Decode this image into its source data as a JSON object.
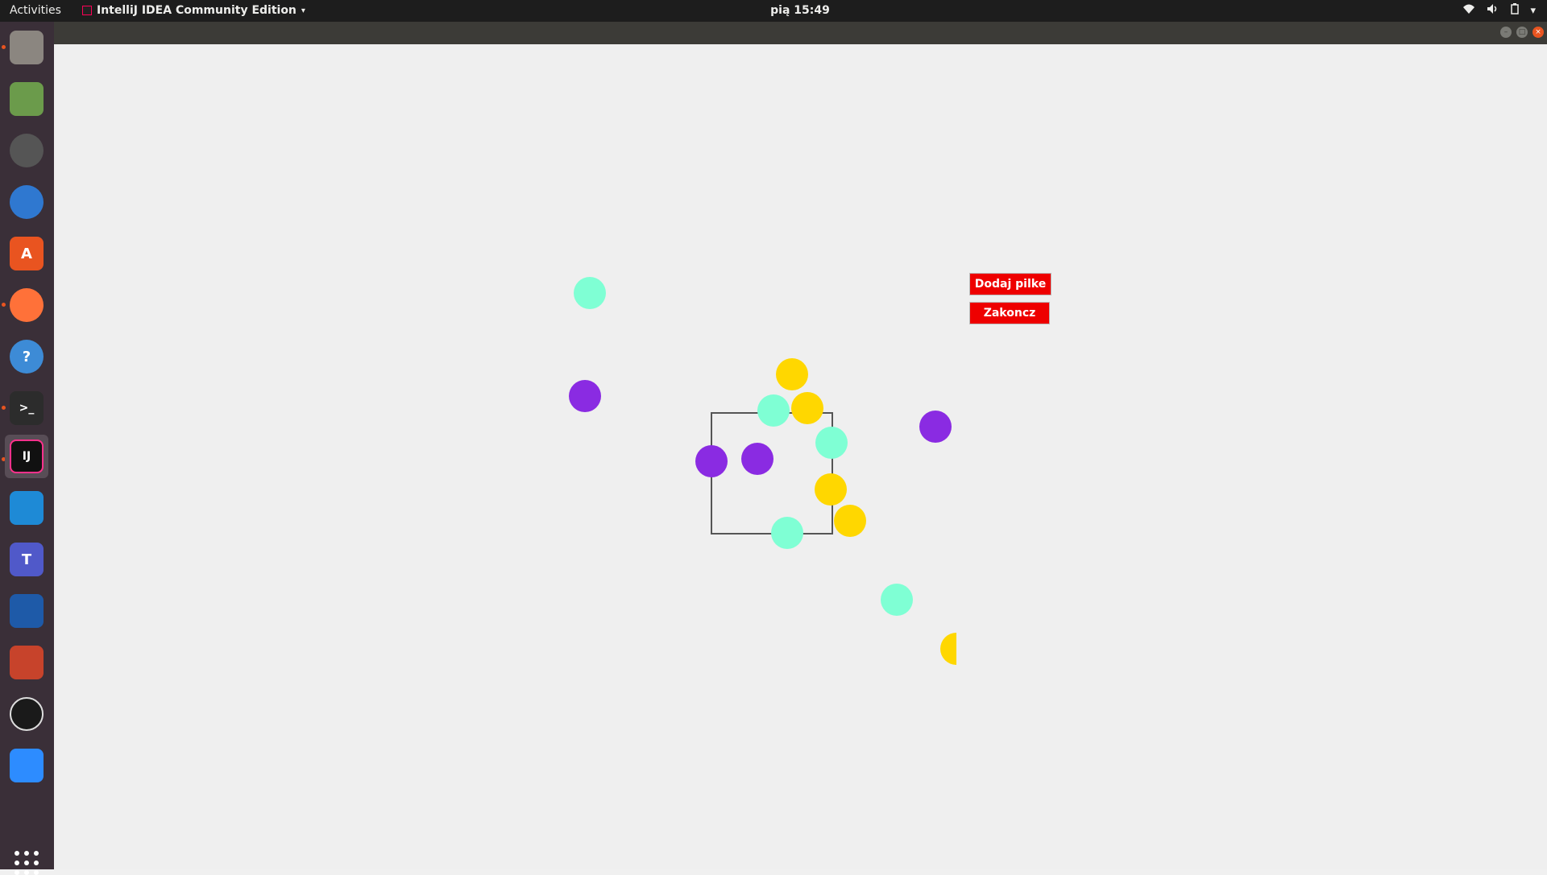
{
  "topbar": {
    "activities": "Activities",
    "app_name": "IntelliJ IDEA Community Edition",
    "clock": "pią 15:49"
  },
  "dock": {
    "items": [
      {
        "name": "files-icon"
      },
      {
        "name": "image-viewer-icon"
      },
      {
        "name": "rhythmbox-icon"
      },
      {
        "name": "thunderbird-icon"
      },
      {
        "name": "software-center-icon"
      },
      {
        "name": "firefox-icon"
      },
      {
        "name": "help-icon"
      },
      {
        "name": "terminal-icon"
      },
      {
        "name": "intellij-icon",
        "label": "IJ"
      },
      {
        "name": "vscode-icon"
      },
      {
        "name": "teams-icon",
        "label": "T"
      },
      {
        "name": "writer-icon"
      },
      {
        "name": "impress-icon"
      },
      {
        "name": "obs-icon"
      },
      {
        "name": "zoom-icon"
      }
    ]
  },
  "app": {
    "add_ball_button": "Dodaj pilke",
    "quit_button": "Zakoncz",
    "colors": {
      "cyan": "#7fffd4",
      "purple": "#8a2be2",
      "yellow": "#ffd700",
      "button_red": "#ee0000"
    },
    "balls": [
      {
        "color": "cyan"
      },
      {
        "color": "purple"
      },
      {
        "color": "yellow"
      },
      {
        "color": "cyan"
      },
      {
        "color": "yellow"
      },
      {
        "color": "cyan"
      },
      {
        "color": "purple"
      },
      {
        "color": "purple"
      },
      {
        "color": "purple"
      },
      {
        "color": "yellow"
      },
      {
        "color": "yellow"
      },
      {
        "color": "cyan"
      },
      {
        "color": "cyan"
      },
      {
        "color": "yellow"
      }
    ]
  }
}
